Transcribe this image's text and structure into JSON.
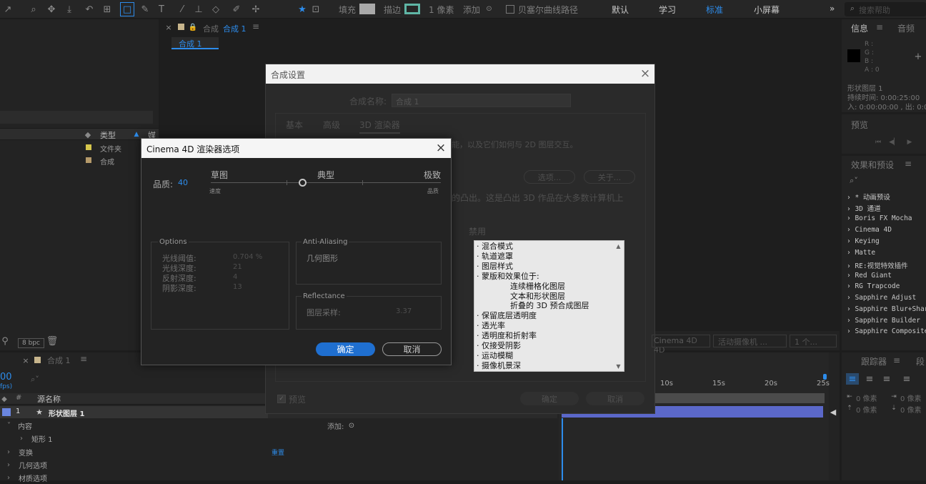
{
  "toolbar": {
    "fill_label": "填充",
    "stroke_label": "描边",
    "stroke_width": "1 像素",
    "add_label": "添加",
    "bezier_label": "贝塞尔曲线路径",
    "workspaces": [
      "默认",
      "学习",
      "标准",
      "小屏幕"
    ],
    "active_workspace": "标准",
    "more": "»",
    "search_placeholder": "搜索帮助",
    "accent": "#2d8ceb"
  },
  "comp_tab": {
    "label_prefix": "合成",
    "label_active": "合成 1",
    "menu": "≡",
    "subtab": "合成 1"
  },
  "project": {
    "col_type": "类型",
    "col_media": "媒",
    "items": [
      {
        "color": "#d6c64c",
        "type": "文件夹"
      },
      {
        "color": "#b59a6a",
        "type": "合成"
      }
    ],
    "bpc": "8 bpc"
  },
  "info": {
    "tab_info": "信息",
    "tab_audio": "音频",
    "r": "R :",
    "g": "G :",
    "b": "B :",
    "a": "A : 0",
    "layer": "形状图层 1",
    "duration": "持续时间: 0:00:25:00",
    "inout": "入: 0:00:00:00 , 出: 0:00"
  },
  "preview": {
    "title": "预览"
  },
  "effects": {
    "title": "效果和预设",
    "items": [
      "* 动画预设",
      "3D 通道",
      "Boris FX Mocha",
      "Cinema 4D",
      "Keying",
      "Matte",
      "RE:视觉特效插件",
      "Red Giant",
      "RG Trapcode",
      "Sapphire Adjust",
      "Sapphire Blur+Sharpen",
      "Sapphire Builder",
      "Sapphire Composite"
    ]
  },
  "tracker": {
    "title": "跟踪器",
    "tab2": "段",
    "px1": "0 像素",
    "px2": "0 像素",
    "px3": "0 像素",
    "px4": "0 像素"
  },
  "timeline": {
    "tab": "合成 1",
    "time": "00",
    "fps": "fps)",
    "col_hash": "#",
    "col_name": "源名称",
    "layer_num": "1",
    "layer_name": "形状图层 1",
    "rows": [
      "内容",
      "矩形 1",
      "变换",
      "几何选项",
      "材质选项"
    ],
    "add_label": "添加:",
    "reset_label": "重置",
    "ticks": [
      "10s",
      "15s",
      "20s",
      "25s"
    ]
  },
  "comp_settings": {
    "title": "合成设置",
    "name_label": "合成名称:",
    "name_value": "合成 1",
    "tabs": [
      "基本",
      "高级",
      "3D 渲染器"
    ],
    "desc1": "能，以及它们如何与 2D 图层交互。",
    "desc2": "的凸出。这是凸出 3D 作品在大多数计算机上",
    "options_btn": "选项...",
    "about_btn": "关于...",
    "disabled_label": "禁用",
    "disabled_items": [
      "· 混合模式",
      "· 轨道遮罩",
      "· 图层样式",
      "· 蒙版和效果位于:",
      "连续栅格化图层",
      "文本和形状图层",
      "折叠的 3D 预合成图层",
      "· 保留底层透明度",
      "· 透光率",
      "· 透明度和折射率",
      "· 仅接受阴影",
      "· 运动模糊",
      "· 摄像机景深"
    ],
    "preview_label": "预览",
    "ok": "确定",
    "cancel": "取消",
    "renderer": "Cinema 4D",
    "camera": "活动摄像机 ...",
    "count": "1 个..."
  },
  "c4d": {
    "title": "Cinema 4D 渲染器选项",
    "quality_label": "品质:",
    "quality_value": "40",
    "quality_fraction": 0.4,
    "draft": "草图",
    "typical": "典型",
    "extreme": "极致",
    "speed": "速度",
    "quality_end": "品质",
    "options_title": "Options",
    "options": [
      {
        "label": "光线阈值:",
        "value": "0.704 %"
      },
      {
        "label": "光线深度:",
        "value": "21"
      },
      {
        "label": "反射深度:",
        "value": "4"
      },
      {
        "label": "阴影深度:",
        "value": "13"
      }
    ],
    "aa_title": "Anti-Aliasing",
    "aa_value": "几何图形",
    "refl_title": "Reflectance",
    "refl_label": "图层采样:",
    "refl_value": "3.37",
    "ok": "确定",
    "cancel": "取消"
  }
}
